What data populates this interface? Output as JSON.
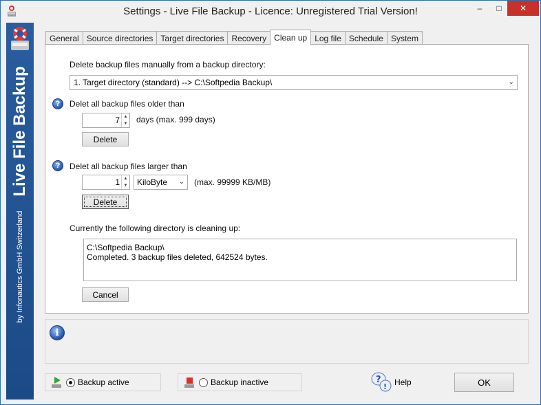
{
  "window": {
    "title": "Settings - Live File Backup - Licence: Unregistered Trial Version!",
    "close_glyph": "✕",
    "min_glyph": "–",
    "max_glyph": "□"
  },
  "sidebar": {
    "brand": "Live File Backup",
    "company": "by Infonautics GmbH Switzerland"
  },
  "tabs": [
    {
      "label": "General",
      "active": false
    },
    {
      "label": "Source directories",
      "active": false
    },
    {
      "label": "Target directories",
      "active": false
    },
    {
      "label": "Recovery",
      "active": false
    },
    {
      "label": "Clean up",
      "active": true
    },
    {
      "label": "Log file",
      "active": false
    },
    {
      "label": "Schedule",
      "active": false
    },
    {
      "label": "System",
      "active": false
    }
  ],
  "cleanup": {
    "manual_label": "Delete backup files manually from a backup directory:",
    "directory_selected": "1. Target directory (standard) --> C:\\Softpedia Backup\\",
    "older_label": "Delet all backup files older than",
    "older_value": "7",
    "older_unit": "days (max. 999 days)",
    "older_delete": "Delete",
    "larger_label": "Delet all backup files larger than",
    "larger_value": "1",
    "larger_unit_selected": "KiloByte",
    "larger_max": "(max. 99999 KB/MB)",
    "larger_delete": "Delete",
    "current_label": "Currently the following directory is cleaning up:",
    "log_lines": [
      "C:\\Softpedia Backup\\",
      "Completed. 3 backup files deleted, 642524 bytes."
    ],
    "cancel": "Cancel"
  },
  "icons": {
    "help_glyph": "?",
    "info_glyph": "i",
    "arrow_up": "▲",
    "arrow_down": "▼",
    "dropdown_arrow": "⌄"
  },
  "footer": {
    "backup_active": "Backup active",
    "backup_inactive": "Backup inactive",
    "help": "Help",
    "ok": "OK"
  },
  "colors": {
    "accent_blue": "#1f4e8c",
    "close_red": "#c7312a",
    "active_green": "#2ea82e",
    "inactive_red": "#d8302a"
  }
}
